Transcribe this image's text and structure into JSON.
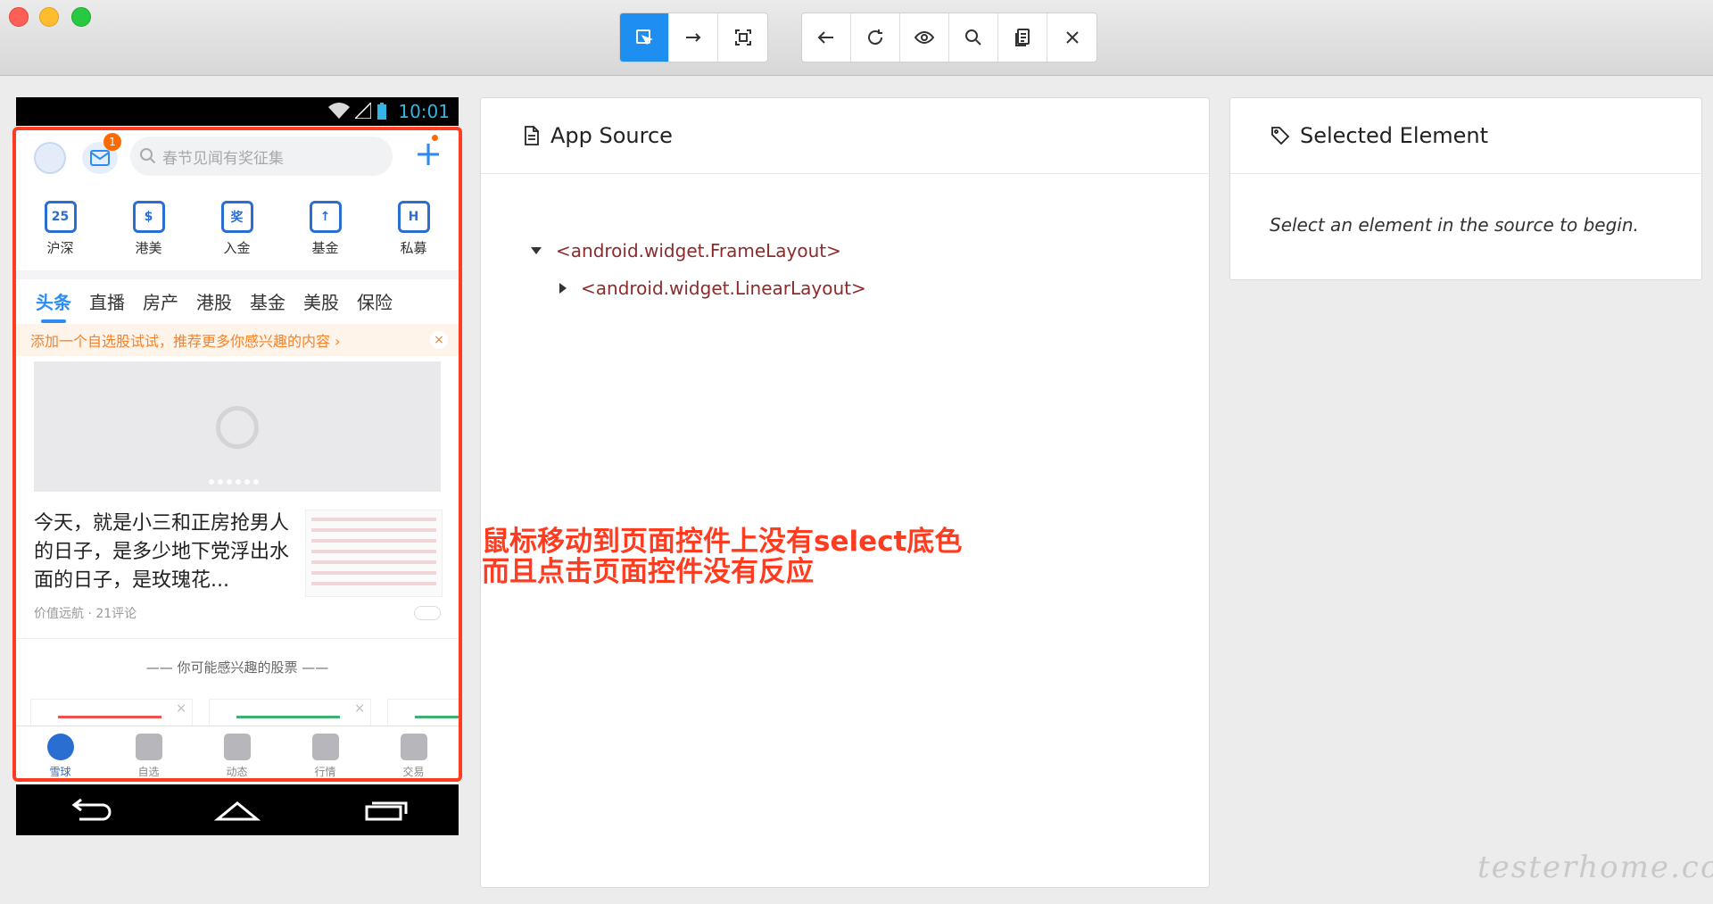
{
  "toolbar": {
    "group1": [
      "select-element",
      "swipe",
      "tap-by-coordinates"
    ],
    "group2": [
      "back",
      "refresh",
      "show-hide",
      "search",
      "copy-xml",
      "quit-session"
    ]
  },
  "phone": {
    "status_time": "10:01",
    "search_placeholder": "春节见闻有奖征集",
    "mail_badge": "1",
    "quick_items": [
      "沪深",
      "港美",
      "入金",
      "基金",
      "私募"
    ],
    "quick_glyphs": [
      "25",
      "$",
      "奖",
      "↑",
      "H"
    ],
    "tabs": [
      "头条",
      "直播",
      "房产",
      "港股",
      "基金",
      "美股",
      "保险"
    ],
    "notice": "添加一个自选股试试，推荐更多你感兴趣的内容 ›",
    "notice_close": "×",
    "article_title": "今天，就是小三和正房抢男人的日子，是多少地下党浮出水面的日子，是玫瑰花...",
    "article_meta": "价值远航 · 21评论",
    "rec_title": "—— 你可能感兴趣的股票 ——",
    "bottom_nav": [
      "雪球",
      "自选",
      "动态",
      "行情",
      "交易"
    ]
  },
  "source_panel": {
    "title": "App Source",
    "nodes": [
      "<android.widget.FrameLayout>",
      "<android.widget.LinearLayout>"
    ]
  },
  "selected_panel": {
    "title": "Selected Element",
    "empty_text": "Select an element in the source to begin."
  },
  "annotation": {
    "line1": "鼠标移动到页面控件上没有select底色",
    "line2": "而且点击页面控件没有反应"
  },
  "watermark": "testerhome.com",
  "colors": {
    "accent": "#1f8ef1",
    "annotation": "#ff3b20"
  }
}
